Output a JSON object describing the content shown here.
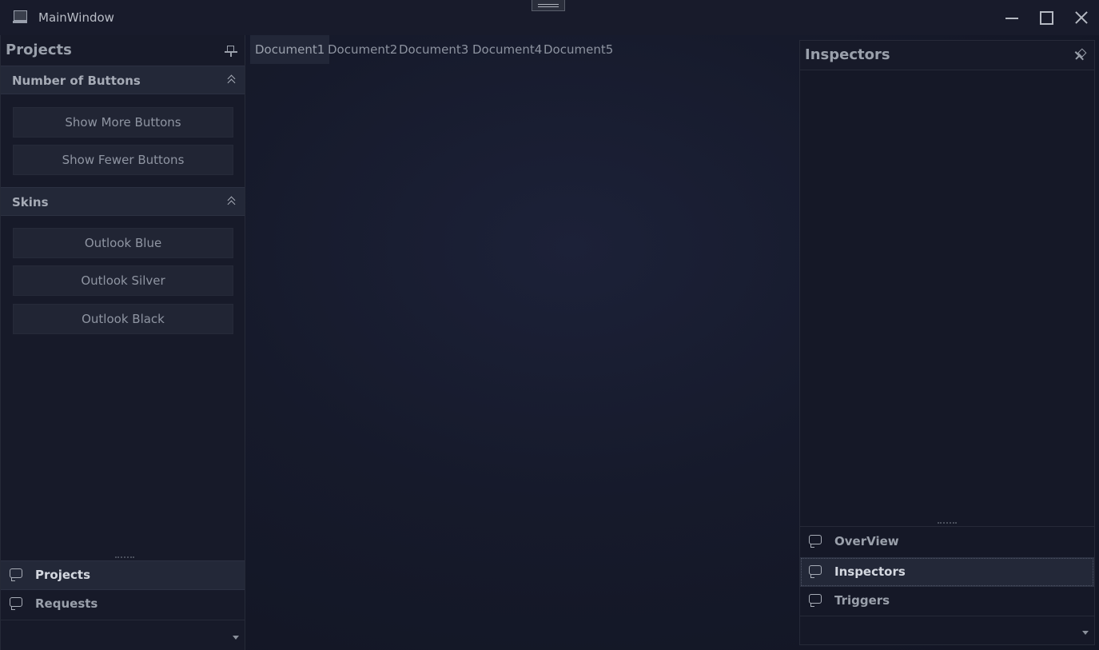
{
  "window": {
    "title": "MainWindow"
  },
  "left_panel": {
    "title": "Projects",
    "sections": [
      {
        "label": "Number of Buttons",
        "buttons": [
          "Show More Buttons",
          "Show Fewer Buttons"
        ]
      },
      {
        "label": "Skins",
        "buttons": [
          "Outlook Blue",
          "Outlook Silver",
          "Outlook Black"
        ]
      }
    ],
    "nav": [
      {
        "label": "Projects",
        "icon": "chat-bubble-icon",
        "active": true
      },
      {
        "label": "Requests",
        "icon": "chat-bubble-icon",
        "active": false
      }
    ]
  },
  "tabs": [
    {
      "label": "Document1",
      "active": true
    },
    {
      "label": "Document2",
      "active": false
    },
    {
      "label": "Document3",
      "active": false
    },
    {
      "label": "Document4",
      "active": false
    },
    {
      "label": "Document5",
      "active": false
    }
  ],
  "right_panel": {
    "title": "Inspectors",
    "nav": [
      {
        "label": "OverView",
        "icon": "chat-bubble-icon",
        "active": false
      },
      {
        "label": "Inspectors",
        "icon": "chat-bubble-icon",
        "active": true
      },
      {
        "label": "Triggers",
        "icon": "chat-bubble-icon",
        "active": false
      }
    ]
  },
  "colors": {
    "background": "#151827",
    "panel": "#171a29",
    "section_header": "#232838",
    "button": "#212534",
    "text": "#9aa0ab"
  }
}
